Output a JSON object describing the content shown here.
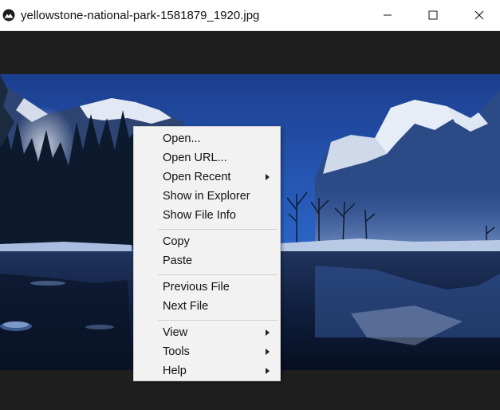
{
  "window": {
    "title": "yellowstone-national-park-1581879_1920.jpg",
    "app_icon": "mountain-app-icon",
    "controls": {
      "minimize_icon": "minimize-icon",
      "maximize_icon": "maximize-icon",
      "close_icon": "close-icon"
    }
  },
  "image": {
    "subject": "snow-capped mountains over a frozen lake at dusk",
    "colors": {
      "sky": "#1d4ea6",
      "mountain_snow": "#e6edf7",
      "water": "#0e1f3d"
    }
  },
  "context_menu": {
    "groups": [
      [
        {
          "label": "Open...",
          "submenu": false
        },
        {
          "label": "Open URL...",
          "submenu": false
        },
        {
          "label": "Open Recent",
          "submenu": true
        },
        {
          "label": "Show in Explorer",
          "submenu": false
        },
        {
          "label": "Show File Info",
          "submenu": false
        }
      ],
      [
        {
          "label": "Copy",
          "submenu": false
        },
        {
          "label": "Paste",
          "submenu": false
        }
      ],
      [
        {
          "label": "Previous File",
          "submenu": false
        },
        {
          "label": "Next File",
          "submenu": false
        }
      ],
      [
        {
          "label": "View",
          "submenu": true
        },
        {
          "label": "Tools",
          "submenu": true
        },
        {
          "label": "Help",
          "submenu": true
        }
      ]
    ]
  }
}
